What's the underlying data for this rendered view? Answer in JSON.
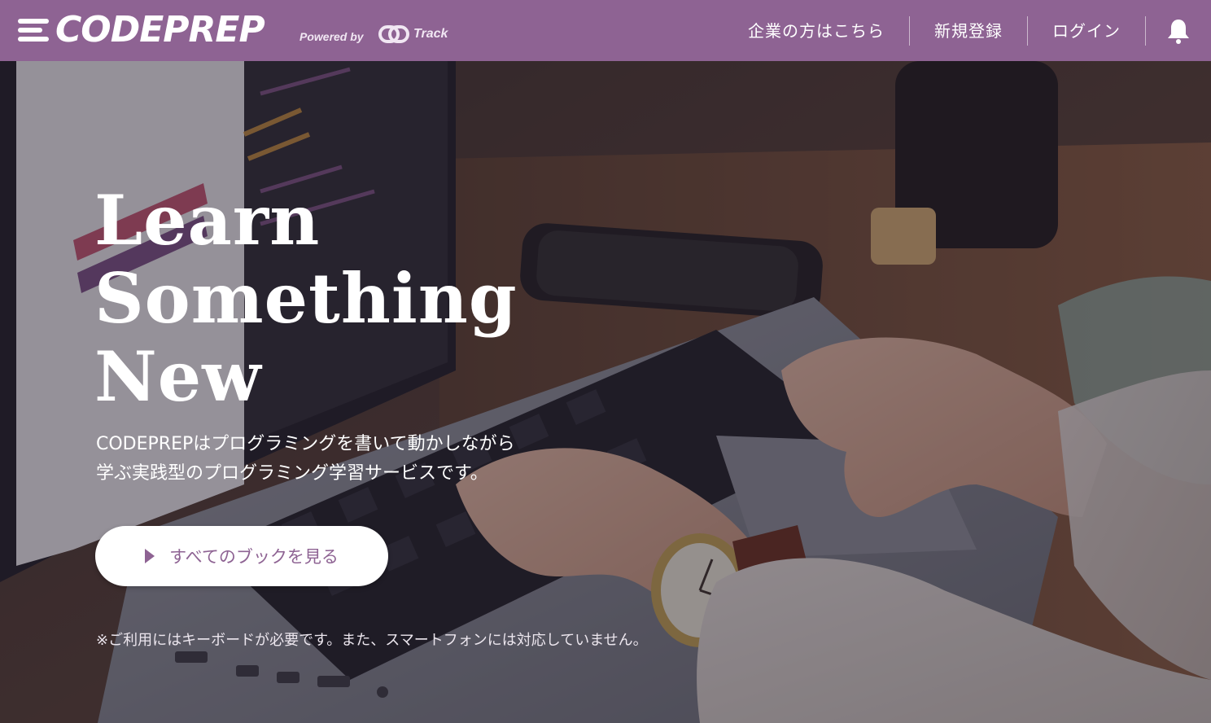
{
  "header": {
    "logo_text": "CODEPREP",
    "powered_by": "Powered by",
    "partner": "Track",
    "nav": [
      {
        "label": "企業の方はこちら"
      },
      {
        "label": "新規登録"
      },
      {
        "label": "ログイン"
      }
    ],
    "bell_icon": "bell-icon",
    "background_color": "#8e6393"
  },
  "hero": {
    "headline_lines": [
      "Learn",
      "Something",
      "New"
    ],
    "lead_line1": "CODEPREPはプログラミングを書いて動かしながら",
    "lead_line2": "学ぶ実践型のプログラミング学習サービスです。",
    "cta_label": "すべてのブックを見る",
    "cta_icon": "play-icon",
    "note": "※ご利用にはキーボードが必要です。また、スマートフォンには対応していません。",
    "accent_color": "#8e6393"
  }
}
